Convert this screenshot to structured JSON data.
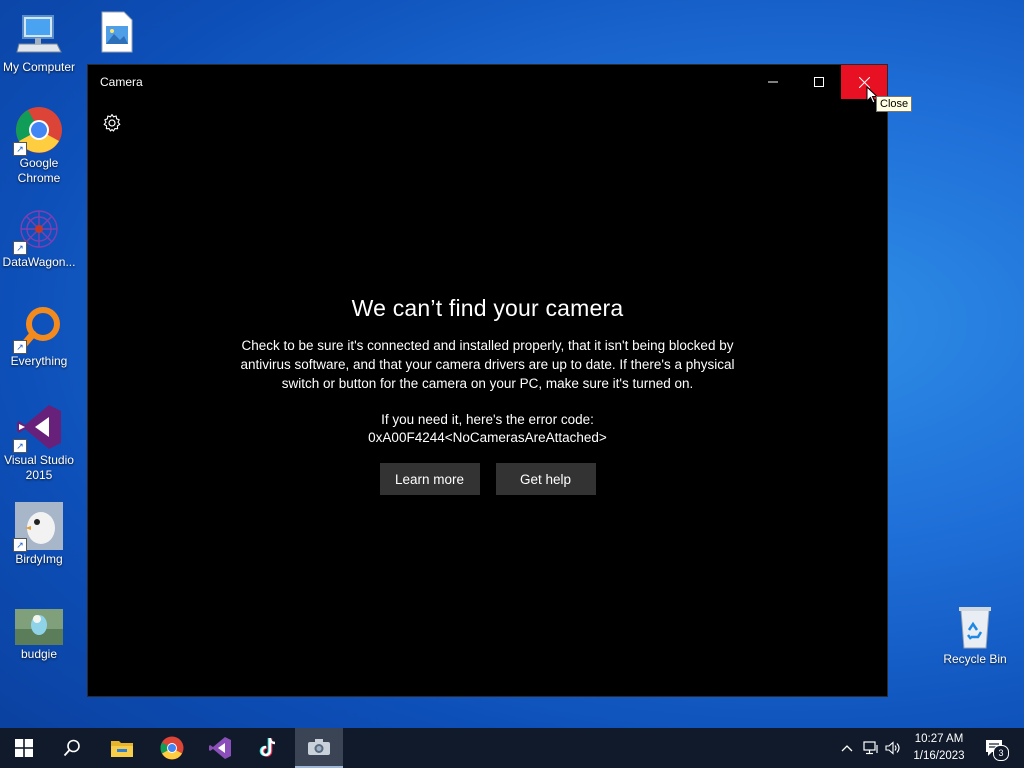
{
  "desktop": {
    "icons": [
      {
        "label": "My Computer",
        "icon": "computer-icon"
      },
      {
        "label": "",
        "icon": "image-file-icon"
      },
      {
        "label": "Google Chrome",
        "icon": "chrome-icon"
      },
      {
        "label": "DataWagon...",
        "icon": "datawagon-icon"
      },
      {
        "label": "Everything",
        "icon": "everything-icon"
      },
      {
        "label": "Visual Studio 2015",
        "icon": "visual-studio-icon"
      },
      {
        "label": "BirdyImg",
        "icon": "birdyimg-icon"
      },
      {
        "label": "budgie",
        "icon": "budgie-image-icon"
      },
      {
        "label": "Recycle Bin",
        "icon": "recycle-bin-icon"
      }
    ]
  },
  "window": {
    "title": "Camera",
    "heading": "We can’t find your camera",
    "description": "Check to be sure it's connected and installed properly, that it isn't being blocked by antivirus software, and that your camera drivers are up to date. If there's a physical switch or button for the camera on your PC, make sure it's turned on.",
    "error_label": "If you need it, here's the error code:",
    "error_code": "0xA00F4244<NoCamerasAreAttached>",
    "learn_more": "Learn more",
    "get_help": "Get help"
  },
  "tooltip": "Close",
  "taskbar": {
    "items": [
      "start-icon",
      "search-icon",
      "file-explorer-icon",
      "chrome-icon",
      "visual-studio-icon",
      "tiktok-icon",
      "camera-icon"
    ],
    "active": "camera-icon",
    "clock_time": "10:27 AM",
    "clock_date": "1/16/2023",
    "notification_count": "3"
  },
  "colors": {
    "close_button": "#e81123",
    "window_bg": "#000000",
    "button_bg": "#333333",
    "taskbar_bg": "#101a2a"
  }
}
